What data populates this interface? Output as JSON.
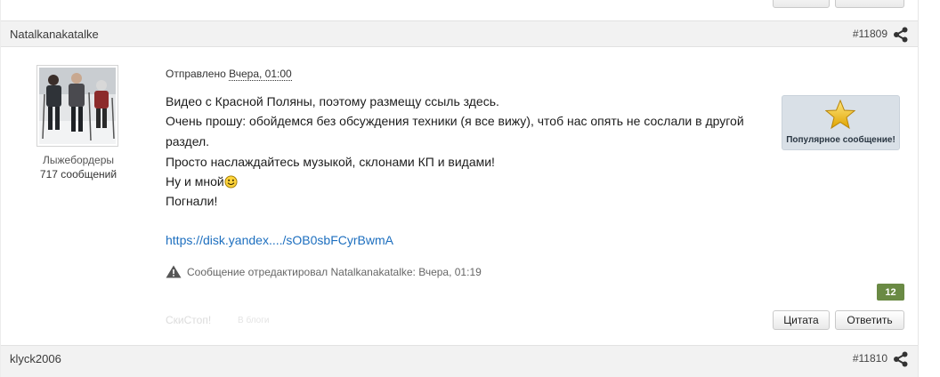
{
  "top_buttons": {
    "quote_label": "",
    "reply_label": ""
  },
  "post": {
    "author": "Natalkanakatalke",
    "number": "#11809",
    "user_group": "Лыжебордеры",
    "post_count": "717 сообщений",
    "sent_label": "Отправлено",
    "sent_date": "Вчера, 01:00",
    "lines": [
      "Видео с Красной Поляны, поэтому размещу ссыль здесь.",
      "Очень прошу: обойдемся без обсуждения техники (я все вижу), чтоб нас опять не сослали в другой",
      "раздел.",
      "Просто наслаждайтесь музыкой, склонами КП и видами!",
      "Ну и мной",
      "Погнали!"
    ],
    "link_text": "https://disk.yandex..../sOB0sbFCyrBwmA",
    "edit_note": "Сообщение отредактировал Natalkanakatalke: Вчера, 01:19",
    "popular_label": "Популярное сообщение!",
    "reputation": "12",
    "signature_text": "СкиСтоп!",
    "blog_text": "В блоги",
    "quote_label": "Цитата",
    "reply_label": "Ответить"
  },
  "next_post": {
    "author": "klyck2006",
    "number": "#11810"
  },
  "icons": [
    "share-icon",
    "warning-icon",
    "star-icon",
    "smiley-icon",
    "avatar-image"
  ],
  "colors": {
    "link": "#1d6fbf",
    "reputation_badge": "#6a8a44",
    "popular_box": "#d9e0e7",
    "header_bg": "#f2f2f2"
  }
}
